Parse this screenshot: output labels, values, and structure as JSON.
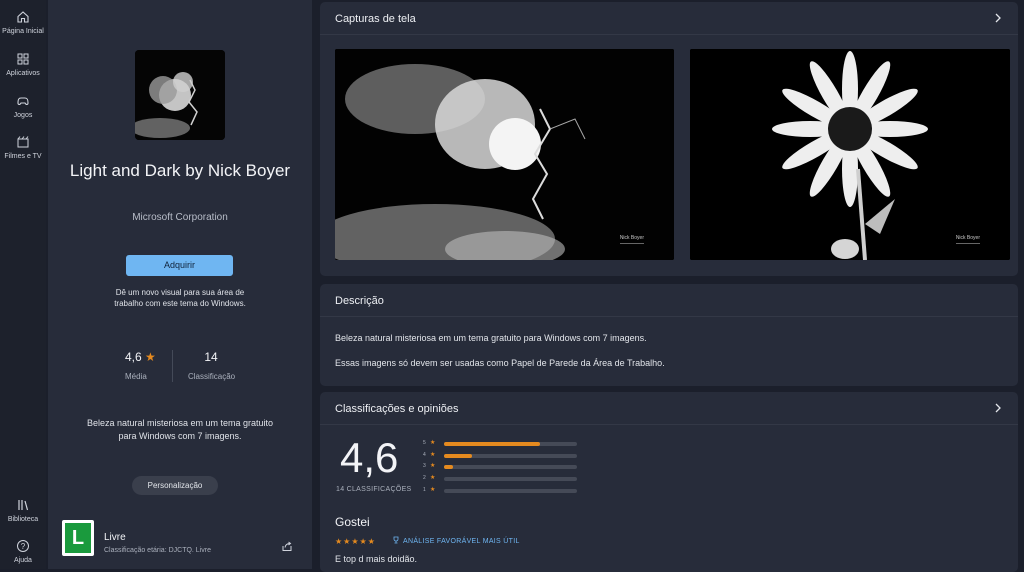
{
  "nav": {
    "items": [
      {
        "label": "Página Inicial",
        "icon": "home-icon"
      },
      {
        "label": "Aplicativos",
        "icon": "apps-icon"
      },
      {
        "label": "Jogos",
        "icon": "gamepad-icon"
      },
      {
        "label": "Filmes e TV",
        "icon": "film-icon"
      }
    ],
    "bottom": [
      {
        "label": "Biblioteca",
        "icon": "library-icon"
      },
      {
        "label": "Ajuda",
        "icon": "help-icon"
      }
    ]
  },
  "app": {
    "title": "Light and Dark by Nick Boyer",
    "publisher": "Microsoft Corporation",
    "get_label": "Adquirir",
    "short_description": "Dê um novo visual para sua área de trabalho com este tema do Windows.",
    "rating_value": "4,6",
    "rating_label": "Média",
    "ratings_count": "14",
    "ratings_count_label": "Classificação",
    "description": "Beleza natural misteriosa em um tema gratuito para Windows com 7 imagens.",
    "tag_label": "Personalização",
    "age_rating": {
      "badge": "L",
      "title": "Livre",
      "description": "Classificação etária: DJCTQ. Livre"
    }
  },
  "screenshots": {
    "title": "Capturas de tela",
    "items": [
      {
        "caption": "Nick Boyer"
      },
      {
        "caption": "Nick Boyer"
      }
    ]
  },
  "description_card": {
    "title": "Descrição",
    "lines": [
      "Beleza natural misteriosa em um tema gratuito para Windows com 7 imagens.",
      "Essas imagens só devem ser usadas como Papel de Parede da Área de Trabalho."
    ]
  },
  "ratings_card": {
    "title": "Classificações e opiniões",
    "average": "4,6",
    "count_label": "14 CLASSIFICAÇÕES",
    "distribution": [
      {
        "stars": "5",
        "fraction": 0.72
      },
      {
        "stars": "4",
        "fraction": 0.21
      },
      {
        "stars": "3",
        "fraction": 0.07
      },
      {
        "stars": "2",
        "fraction": 0.0
      },
      {
        "stars": "1",
        "fraction": 0.0
      }
    ],
    "review": {
      "title": "Gostei",
      "stars": "★★★★★",
      "badge": "ANÁLISE FAVORÁVEL MAIS ÚTIL",
      "text": "E top d mais doidão."
    }
  },
  "colors": {
    "accent": "#6fb6f2",
    "star": "#e58a1f",
    "background": "#1b1f2b",
    "card": "#272c3a"
  }
}
